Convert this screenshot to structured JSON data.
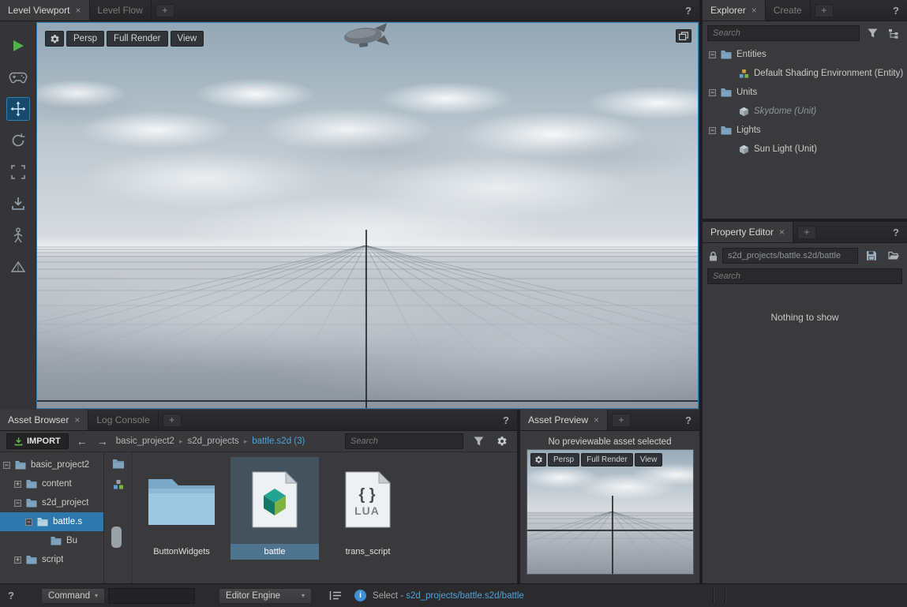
{
  "glyphs": {
    "close": "×",
    "plus": "+",
    "help": "?",
    "crumb_sep": "▸",
    "back": "←",
    "forward": "→",
    "caret": "▾",
    "info": "i"
  },
  "colors": {
    "selection_blue": "#2d79ae",
    "link_blue": "#4da3d9",
    "play_green": "#4fb348",
    "panel_bg": "#3a3a3c",
    "tabbar_bg": "#28282a",
    "viewport_border_blue": "#2e7fb5"
  },
  "level_viewport": {
    "tabs": [
      {
        "label": "Level Viewport"
      },
      {
        "label": "Level Flow"
      }
    ],
    "toolbar": {
      "persp": "Persp",
      "full_render": "Full Render",
      "view": "View"
    }
  },
  "explorer": {
    "tabs": [
      {
        "label": "Explorer"
      },
      {
        "label": "Create"
      }
    ],
    "search_placeholder": "Search",
    "tree": [
      {
        "label": "Entities",
        "expander": "−"
      },
      {
        "label": "Default Shading Environment (Entity)"
      },
      {
        "label": "Units",
        "expander": "−"
      },
      {
        "label": "Skydome (Unit)"
      },
      {
        "label": "Lights",
        "expander": "−"
      },
      {
        "label": "Sun Light (Unit)"
      }
    ]
  },
  "property_editor": {
    "tab": "Property Editor",
    "path": "s2d_projects/battle.s2d/battle",
    "search_placeholder": "Search",
    "empty_message": "Nothing to show"
  },
  "asset_browser": {
    "tabs": [
      {
        "label": "Asset Browser"
      },
      {
        "label": "Log Console"
      }
    ],
    "import_label": "IMPORT",
    "breadcrumb": [
      "basic_project2",
      "s2d_projects",
      "battle.s2d (3)"
    ],
    "search_placeholder": "Search",
    "tree": [
      {
        "label": "basic_project2",
        "expander": "−"
      },
      {
        "label": "content",
        "expander": "+"
      },
      {
        "label": "s2d_project",
        "expander": "−"
      },
      {
        "label": "battle.s",
        "expander": "−"
      },
      {
        "label": "Bu"
      },
      {
        "label": "script",
        "expander": "+"
      }
    ],
    "assets": [
      {
        "name": "ButtonWidgets"
      },
      {
        "name": "battle"
      },
      {
        "name": "trans_script",
        "glyph": "{ }",
        "badge": "LUA"
      }
    ]
  },
  "asset_preview": {
    "tab": "Asset Preview",
    "message": "No previewable asset selected",
    "toolbar": {
      "persp": "Persp",
      "full_render": "Full Render",
      "view": "View"
    }
  },
  "status_bar": {
    "command_label": "Command",
    "engine_label": "Editor Engine",
    "status_prefix": "Select - ",
    "status_link": "s2d_projects/battle.s2d/battle"
  }
}
